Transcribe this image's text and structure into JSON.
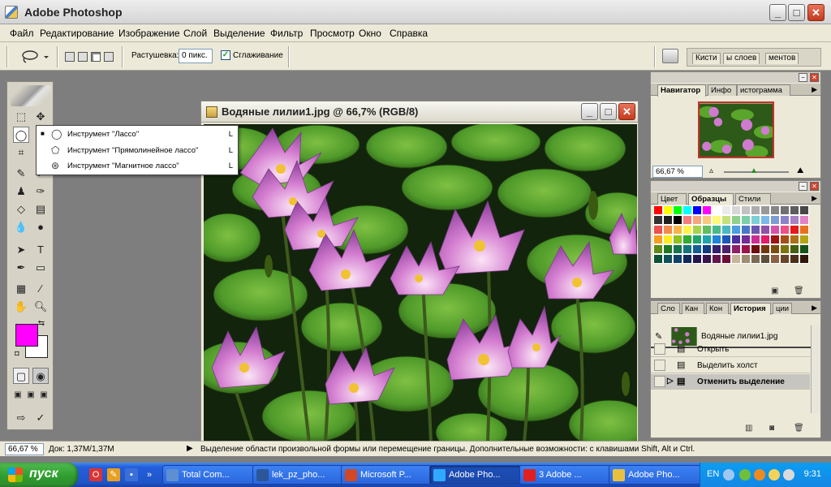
{
  "app": {
    "title": "Adobe Photoshop"
  },
  "menu": [
    "Файл",
    "Редактирование",
    "Изображение",
    "Слой",
    "Выделение",
    "Фильтр",
    "Просмотр",
    "Окно",
    "Справка"
  ],
  "options": {
    "feather_label": "Растушевка:",
    "feather_value": "0 пикс.",
    "antialias_label": "Сглаживание",
    "antialias_checked": true,
    "well_tabs": [
      "Кисти",
      "ы слоев",
      "ментов"
    ]
  },
  "toolbox": {
    "foreground_color": "#ff00ff",
    "background_color": "#ffffff"
  },
  "flyout": {
    "items": [
      {
        "label": "Инструмент \"Лассо\"",
        "shortcut": "L",
        "bullet": "■",
        "icon": "lasso-icon"
      },
      {
        "label": "Инструмент \"Прямолинейное лассо\"",
        "shortcut": "L",
        "bullet": "",
        "icon": "polygonal-lasso-icon"
      },
      {
        "label": "Инструмент \"Магнитное лассо\"",
        "shortcut": "L",
        "bullet": "",
        "icon": "magnetic-lasso-icon"
      }
    ]
  },
  "document": {
    "title": "Водяные лилии1.jpg @ 66,7% (RGB/8)"
  },
  "navigator": {
    "tabs": [
      "Навигатор",
      "Инфо",
      "Гистограмма"
    ],
    "tab_display": [
      "Навигатор",
      "Инфо",
      "истограмма"
    ],
    "zoom": "66,67 %"
  },
  "swatches": {
    "tabs": [
      "Цвет",
      "Образцы",
      "Стили"
    ],
    "colors": [
      "#ff0000",
      "#ffff00",
      "#00ff00",
      "#00ffff",
      "#0000ff",
      "#ff00ff",
      "#ffffff",
      "#ebebeb",
      "#d6d6d6",
      "#c2c2c2",
      "#adadad",
      "#999999",
      "#858585",
      "#707070",
      "#5c5c5c",
      "#474747",
      "#333333",
      "#1f1f1f",
      "#000000",
      "#f27c7c",
      "#f5a57c",
      "#f9c87c",
      "#fff97c",
      "#c6e17c",
      "#8fd18c",
      "#7ccfa8",
      "#7cd0d4",
      "#7cb9e8",
      "#7c9cd6",
      "#8c82c6",
      "#a882c4",
      "#e282c6",
      "#ef4f4f",
      "#f28a4a",
      "#f8b44a",
      "#fff24a",
      "#a8d24a",
      "#5fbf5f",
      "#4ab98a",
      "#4ab8c0",
      "#4a9fe0",
      "#4a78c8",
      "#6a56b0",
      "#8c52ac",
      "#d652aa",
      "#ee4f86",
      "#e31b1b",
      "#ea7020",
      "#f59e20",
      "#ffec20",
      "#8dc31e",
      "#31ab31",
      "#1fa46d",
      "#1ea4b0",
      "#1e85d8",
      "#1e57b8",
      "#4b2f9e",
      "#732c98",
      "#cb2c94",
      "#e21b6a",
      "#9f1313",
      "#a44f16",
      "#ad7016",
      "#b4a516",
      "#628915",
      "#227722",
      "#15744c",
      "#15737c",
      "#155d97",
      "#153c80",
      "#34206e",
      "#501e6a",
      "#8e1f68",
      "#9e134a",
      "#6e0d0d",
      "#73370f",
      "#794e0f",
      "#7e740f",
      "#44600e",
      "#185318",
      "#0f5135",
      "#0f5157",
      "#0f416a",
      "#0f2a5a",
      "#24164d",
      "#38154a",
      "#631549",
      "#6e0d33",
      "#c8b49a",
      "#a08c70",
      "#7c6a52",
      "#5e4e3a",
      "#8c6040",
      "#6a4428",
      "#4c2e18",
      "#30180a"
    ]
  },
  "history": {
    "tabs": [
      "Слои",
      "Каналы",
      "Контуры",
      "История",
      "Операции"
    ],
    "tab_display": [
      "Сло",
      "Кан",
      "Кон",
      "История",
      "ции"
    ],
    "snapshot": "Водяные лилии1.jpg",
    "steps": [
      "Открыть",
      "Выделить холст",
      "Отменить выделение"
    ],
    "active_step": 2
  },
  "status": {
    "zoom": "66,67 %",
    "doc": "Док: 1,37M/1,37M",
    "message": "Выделение области произвольной формы или перемещение границы. Дополнительные возможности: с клавишами Shift, Alt и Ctrl."
  },
  "taskbar": {
    "start": "пуск",
    "tasks": [
      {
        "label": "Total Com...",
        "color": "#5e8fd2",
        "active": false
      },
      {
        "label": "lek_pz_pho...",
        "color": "#2b579a",
        "active": false
      },
      {
        "label": "Microsoft P...",
        "color": "#d24726",
        "active": false
      },
      {
        "label": "Adobe Pho...",
        "color": "#31a8ff",
        "active": true
      },
      {
        "label": "3 Adobe ...",
        "color": "#e02020",
        "active": false
      },
      {
        "label": "Adobe Pho...",
        "color": "#e8c040",
        "active": false
      }
    ],
    "lang": "EN",
    "clock": "9:31"
  }
}
